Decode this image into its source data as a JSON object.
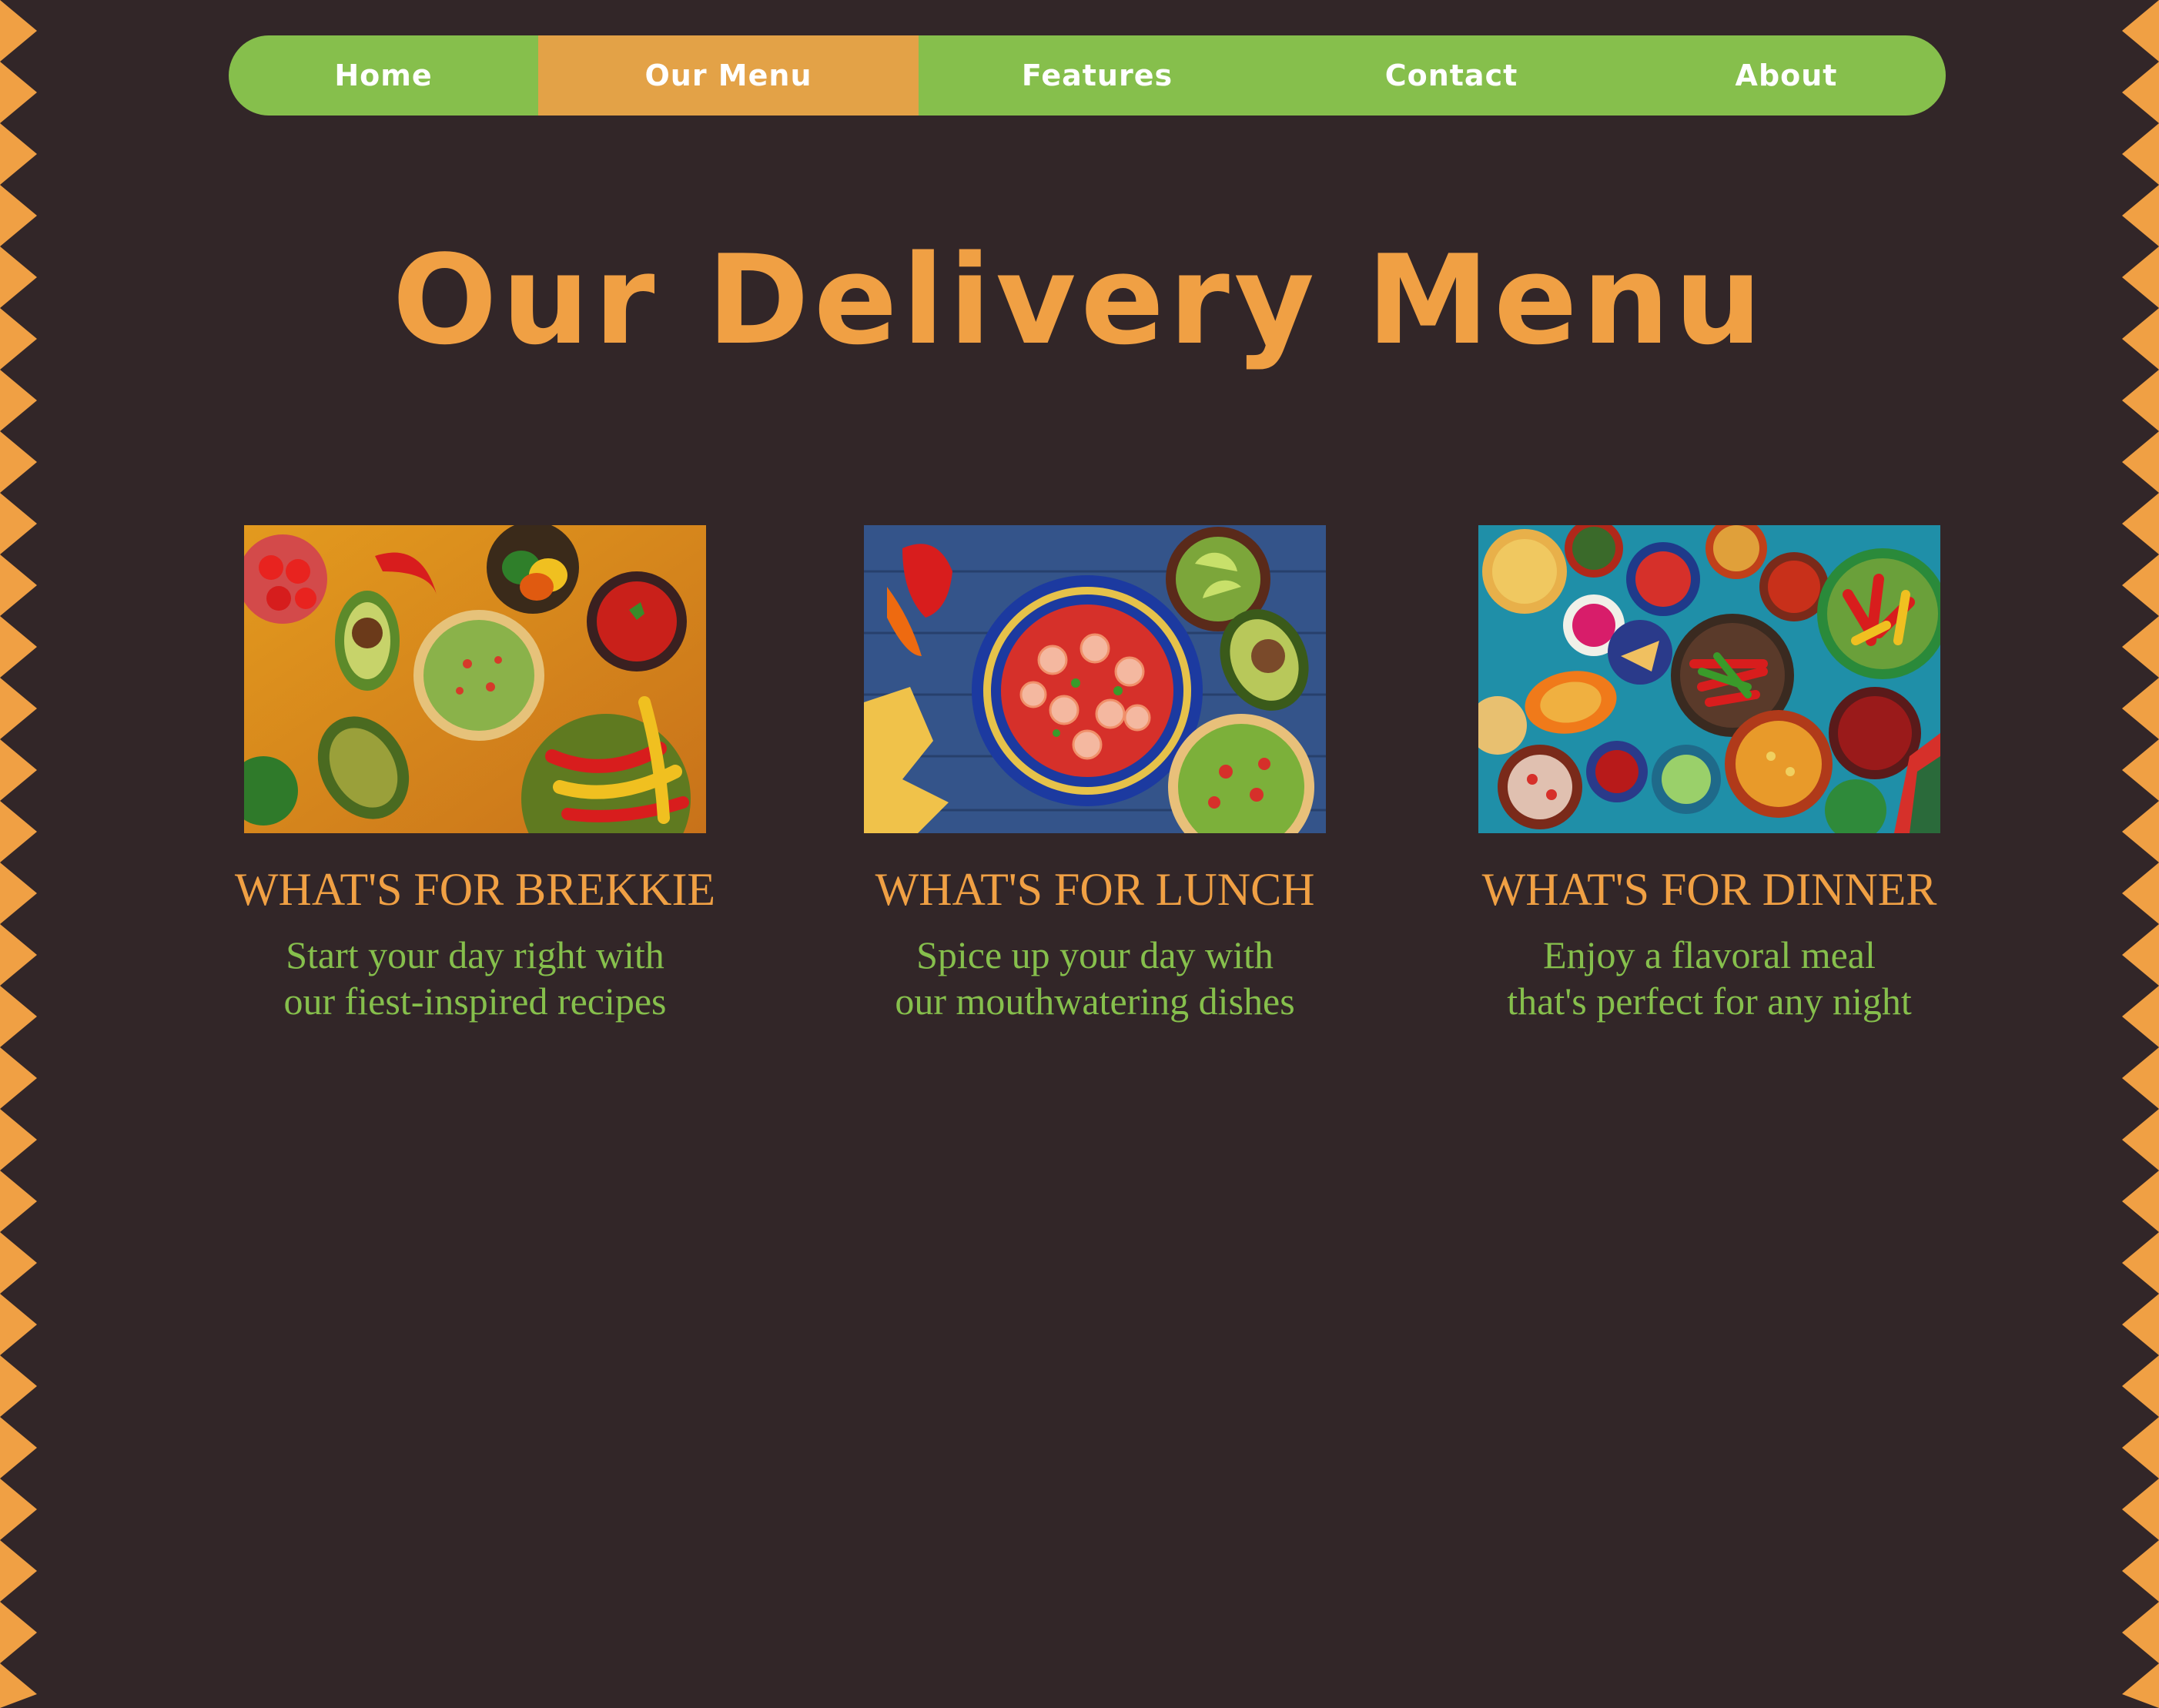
{
  "nav": {
    "items": [
      {
        "label": "Home"
      },
      {
        "label": "Our Menu"
      },
      {
        "label": "Features"
      },
      {
        "label": "Contact"
      },
      {
        "label": "About"
      }
    ],
    "active_label": "Our Menu"
  },
  "page": {
    "title": "Our Delivery Menu"
  },
  "cards": [
    {
      "title": "WHAT'S FOR BREKKIE",
      "desc": "Start your day right with\nour fiest-inspired recipes",
      "image": "breakfast-food-photo"
    },
    {
      "title": "WHAT'S FOR LUNCH",
      "desc": "Spice up your day with\nour mouthwatering dishes",
      "image": "lunch-food-photo"
    },
    {
      "title": "WHAT'S FOR DINNER",
      "desc": "Enjoy a flavoral meal\nthat's perfect for any night",
      "image": "dinner-food-photo"
    }
  ],
  "colors": {
    "background": "#322628",
    "accent_orange": "#f0a044",
    "nav_green": "#86bf4c",
    "nav_active": "#e3a247"
  }
}
